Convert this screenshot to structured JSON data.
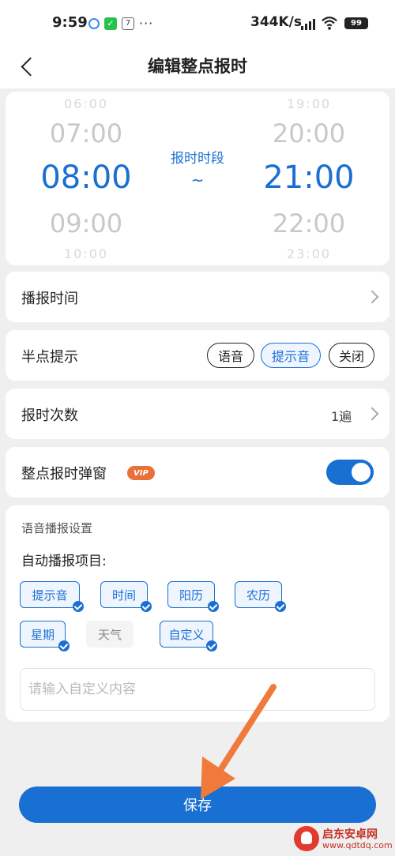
{
  "status_bar": {
    "time": "9:59",
    "calendar_day": "7",
    "more": "···",
    "network_speed": "344K/s",
    "battery": "99",
    "net_badge": "HD"
  },
  "header": {
    "title": "编辑整点报时"
  },
  "time_picker": {
    "left": {
      "far_top": "06:00",
      "near_top": "07:00",
      "selected": "08:00",
      "near_bottom": "09:00",
      "far_bottom": "10:00"
    },
    "middle_label": "报时时段",
    "separator": "~",
    "right": {
      "far_top": "19:00",
      "near_top": "20:00",
      "selected": "21:00",
      "near_bottom": "22:00",
      "far_bottom": "23:00"
    }
  },
  "broadcast_time": {
    "label": "播报时间"
  },
  "half_hour": {
    "label": "半点提示",
    "options": [
      "语音",
      "提示音",
      "关闭"
    ],
    "selected": "提示音"
  },
  "repeat_count": {
    "label": "报时次数",
    "value": "1遍"
  },
  "popup": {
    "label": "整点报时弹窗",
    "badge": "VIP",
    "enabled": true
  },
  "voice_settings": {
    "section_title": "语音播报设置",
    "subtitle": "自动播报项目:",
    "items": [
      {
        "label": "提示音",
        "checked": true
      },
      {
        "label": "时间",
        "checked": true
      },
      {
        "label": "阳历",
        "checked": true
      },
      {
        "label": "农历",
        "checked": true
      },
      {
        "label": "星期",
        "checked": true
      },
      {
        "label": "天气",
        "checked": false
      },
      {
        "label": "自定义",
        "checked": true
      }
    ],
    "custom_placeholder": "请输入自定义内容",
    "custom_value": ""
  },
  "save_button": {
    "label": "保存"
  },
  "watermark": {
    "title": "启东安卓网",
    "url": "www.qdtdq.com"
  },
  "colors": {
    "accent": "#1a6fd2",
    "annotation_arrow": "#f07a3c",
    "watermark": "#c53026"
  },
  "icons": [
    "alarm-icon",
    "wechat-icon",
    "calendar-icon",
    "signal-icon",
    "wifi-icon",
    "battery-icon",
    "back-arrow-icon",
    "chevron-right-icon",
    "check-icon"
  ]
}
